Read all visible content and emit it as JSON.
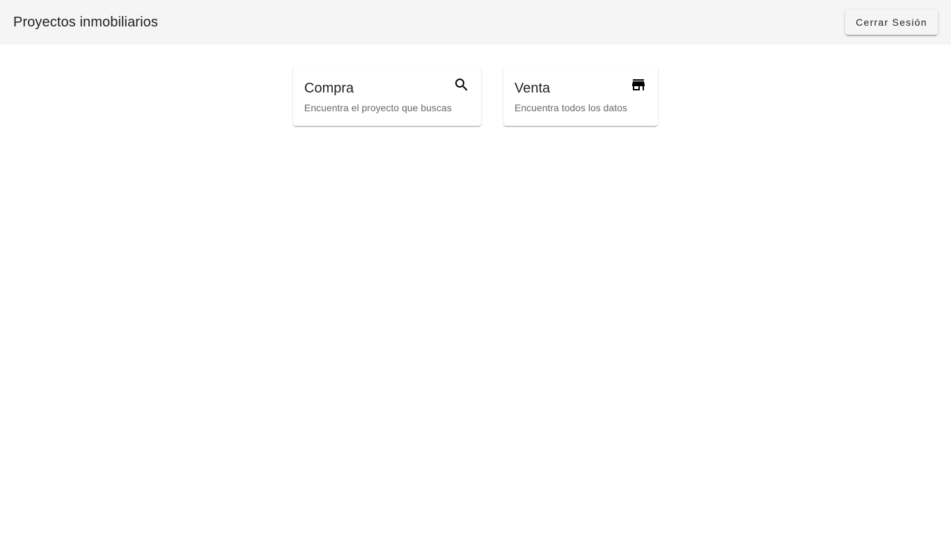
{
  "header": {
    "title": "Proyectos inmobiliarios",
    "logout_label": "Cerrar Sesión"
  },
  "cards": [
    {
      "title": "Compra",
      "subtitle": "Encuentra el proyecto que buscas",
      "icon": "search-icon"
    },
    {
      "title": "Venta",
      "subtitle": "Encuentra todos los datos",
      "icon": "store-icon"
    }
  ],
  "colors": {
    "toolbar_background": "#f5f5f5",
    "page_background": "#ffffff",
    "icon_color": "#000000"
  }
}
